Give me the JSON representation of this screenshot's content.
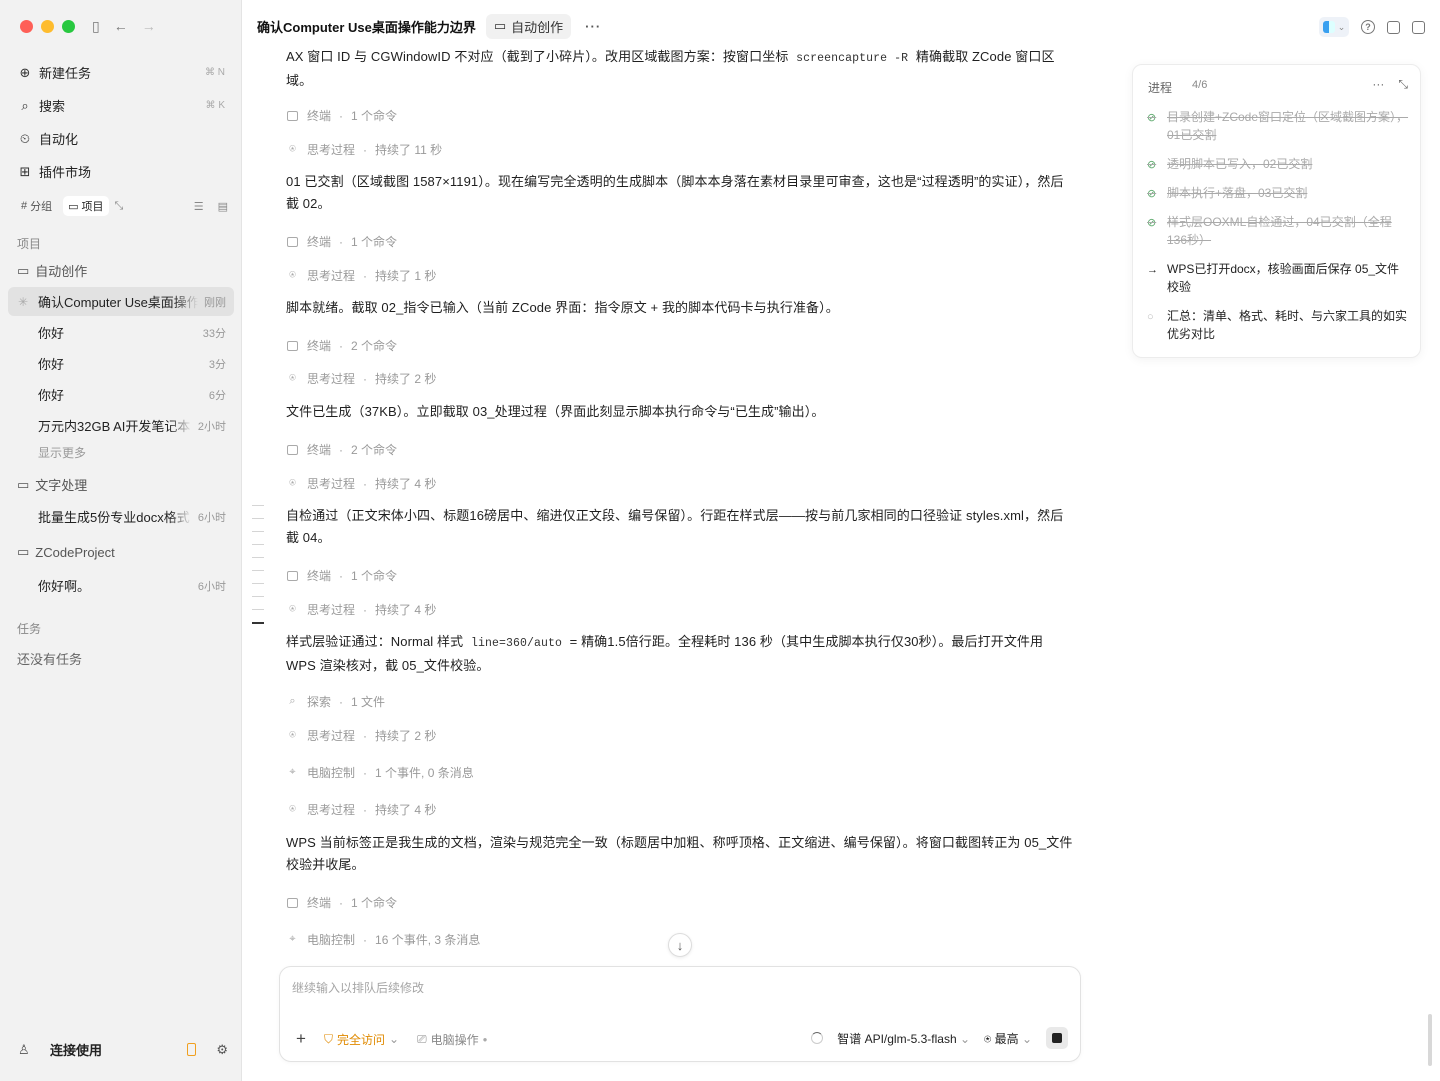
{
  "sidebar": {
    "nav": [
      {
        "label": "新建任务",
        "shortcut": "⌘ N",
        "icon": "new-task-icon"
      },
      {
        "label": "搜索",
        "shortcut": "⌘ K",
        "icon": "search-icon"
      },
      {
        "label": "自动化",
        "shortcut": "",
        "icon": "automation-icon"
      },
      {
        "label": "插件市场",
        "shortcut": "",
        "icon": "plugin-icon"
      }
    ],
    "group_label": "分组",
    "project_label": "项目",
    "projects_heading": "项目",
    "folders": [
      {
        "name": "自动创作",
        "threads": [
          {
            "title": "确认Computer Use桌面操作能力边界",
            "time": "刚刚",
            "active": true
          },
          {
            "title": "你好",
            "time": "33分"
          },
          {
            "title": "你好",
            "time": "3分"
          },
          {
            "title": "你好",
            "time": "6分"
          },
          {
            "title": "万元内32GB AI开发笔记本",
            "time": "2小时"
          }
        ],
        "more": "显示更多"
      },
      {
        "name": "文字处理",
        "threads": [
          {
            "title": "批量生成5份专业docx格式",
            "time": "6小时"
          }
        ]
      },
      {
        "name": "ZCodeProject",
        "threads": [
          {
            "title": "你好啊。",
            "time": "6小时"
          }
        ]
      }
    ],
    "tasks_heading": "任务",
    "tasks_empty": "还没有任务",
    "user_label": "连接使用"
  },
  "header": {
    "title": "确认Computer Use桌面操作能力边界",
    "folder_tag": "自动创作",
    "more": "···"
  },
  "feed": {
    "p0a": "AX 窗口 ID 与 CGWindowID 不对应（截到了小碎片）。改用区域截图方案：按窗口坐标",
    "p0code": "screencapture -R",
    "p0b": "精确截取 ZCode 窗口区域。",
    "s1": {
      "label": "终端",
      "detail": "1 个命令"
    },
    "s2": {
      "label": "思考过程",
      "detail": "持续了 11 秒"
    },
    "p1": "01 已交割（区域截图 1587×1191）。现在编写完全透明的生成脚本（脚本本身落在素材目录里可审查，这也是“过程透明”的实证），然后截 02。",
    "s3": {
      "label": "终端",
      "detail": "1 个命令"
    },
    "s4": {
      "label": "思考过程",
      "detail": "持续了 1 秒"
    },
    "p2": "脚本就绪。截取 02_指令已输入（当前 ZCode 界面：指令原文 + 我的脚本代码卡与执行准备）。",
    "s5": {
      "label": "终端",
      "detail": "2 个命令"
    },
    "s6": {
      "label": "思考过程",
      "detail": "持续了 2 秒"
    },
    "p3": "文件已生成（37KB）。立即截取 03_处理过程（界面此刻显示脚本执行命令与“已生成”输出）。",
    "s7": {
      "label": "终端",
      "detail": "2 个命令"
    },
    "s8": {
      "label": "思考过程",
      "detail": "持续了 4 秒"
    },
    "p4": "自检通过（正文宋体小四、标题16磅居中、缩进仅正文段、编号保留）。行距在样式层——按与前几家相同的口径验证 styles.xml，然后截 04。",
    "s9": {
      "label": "终端",
      "detail": "1 个命令"
    },
    "s10": {
      "label": "思考过程",
      "detail": "持续了 4 秒"
    },
    "p5a": "样式层验证通过：Normal 样式",
    "p5code": "line=360/auto",
    "p5b": "= 精确1.5倍行距。全程耗时 136 秒（其中生成脚本执行仅30秒）。最后打开文件用 WPS 渲染核对，截 05_文件校验。",
    "s11": {
      "label": "探索",
      "detail": "1 文件"
    },
    "s12": {
      "label": "思考过程",
      "detail": "持续了 2 秒"
    },
    "s13": {
      "label": "电脑控制",
      "detail": "1 个事件, 0 条消息"
    },
    "s14": {
      "label": "思考过程",
      "detail": "持续了 4 秒"
    },
    "p6": "WPS 当前标签正是我生成的文档，渲染与规范完全一致（标题居中加粗、称呼顶格、正文缩进、编号保留）。将窗口截图转正为 05_文件校验并收尾。",
    "s15": {
      "label": "终端",
      "detail": "1 个命令"
    },
    "s16": {
      "label": "电脑控制",
      "detail": "16 个事件, 3 条消息"
    },
    "sep": "·"
  },
  "composer": {
    "placeholder": "继续输入以排队后续修改",
    "permission": "完全访问",
    "computer": "电脑操作",
    "model": "智谱 API/glm-5.3-flash",
    "effort": "最高"
  },
  "progress": {
    "title": "进程",
    "count": "4/6",
    "items": [
      {
        "text": "目录创建+ZCode窗口定位（区域截图方案），01已交割",
        "status": "done"
      },
      {
        "text": "透明脚本已写入，02已交割",
        "status": "done"
      },
      {
        "text": "脚本执行+落盘，03已交割",
        "status": "done"
      },
      {
        "text": "样式层OOXML自检通过，04已交割（全程136秒）",
        "status": "done"
      },
      {
        "text": "WPS已打开docx，核验画面后保存 05_文件校验",
        "status": "current"
      },
      {
        "text": "汇总：清单、格式、耗时、与六家工具的如实优劣对比",
        "status": "todo"
      }
    ]
  },
  "colors": {
    "accent_orange": "#e08a00",
    "done_green": "#5aa86a"
  }
}
